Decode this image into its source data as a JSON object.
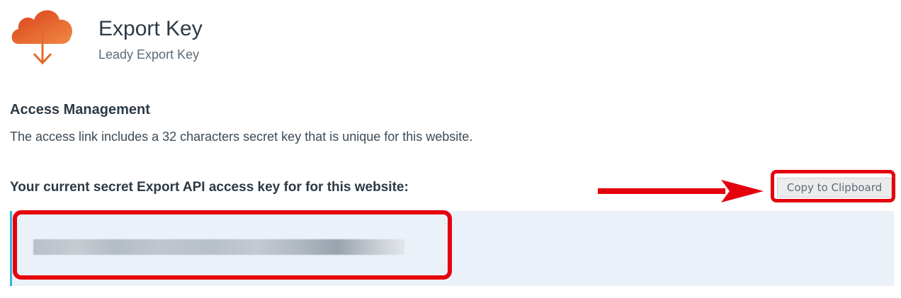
{
  "header": {
    "title": "Export Key",
    "subtitle": "Leady Export Key",
    "logo_icon": "cloud-download-icon",
    "logo_colors": [
      "#e45a23",
      "#f07a3c"
    ]
  },
  "access_management": {
    "heading": "Access Management",
    "description": "The access link includes a 32 characters secret key that is unique for this website."
  },
  "key_section": {
    "label": "Your current secret Export API access key for for this website:",
    "copy_button_label": "Copy to Clipboard",
    "key_value": ""
  },
  "annotations": {
    "highlight_color": "#e5000d",
    "arrow_icon": "arrow-right-icon"
  }
}
